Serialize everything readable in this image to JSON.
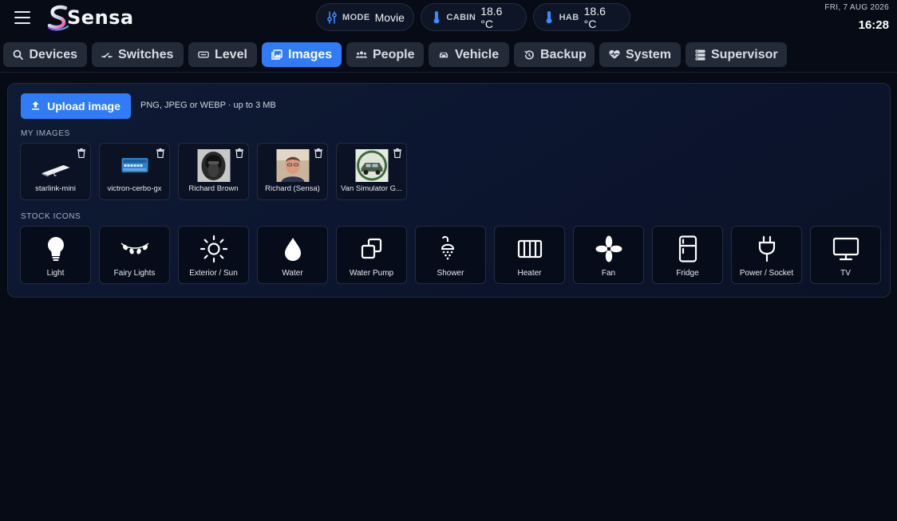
{
  "header": {
    "logo_text": "Sensa",
    "mode": {
      "label": "MODE",
      "value": "Movie"
    },
    "cabin": {
      "label": "CABIN",
      "value": "18.6 °C"
    },
    "hab": {
      "label": "HAB",
      "value": "18.6 °C"
    },
    "date": "FRI, 7 AUG 2026",
    "time": "16:28"
  },
  "tabs": [
    {
      "label": "Devices",
      "icon": "search-icon"
    },
    {
      "label": "Switches",
      "icon": "switch-icon"
    },
    {
      "label": "Level",
      "icon": "level-icon"
    },
    {
      "label": "Images",
      "icon": "image-icon",
      "active": true
    },
    {
      "label": "People",
      "icon": "people-icon"
    },
    {
      "label": "Vehicle",
      "icon": "car-icon"
    },
    {
      "label": "Backup",
      "icon": "history-icon"
    },
    {
      "label": "System",
      "icon": "heart-pulse-icon"
    },
    {
      "label": "Supervisor",
      "icon": "server-icon"
    }
  ],
  "upload": {
    "button_label": "Upload image",
    "hint": "PNG, JPEG or WEBP · up to 3 MB"
  },
  "my_images": {
    "heading": "MY IMAGES",
    "items": [
      {
        "name": "starlink-mini"
      },
      {
        "name": "victron-cerbo-gx"
      },
      {
        "name": "Richard Brown"
      },
      {
        "name": "Richard (Sensa)"
      },
      {
        "name": "Van Simulator G..."
      }
    ]
  },
  "stock_icons": {
    "heading": "STOCK ICONS",
    "items": [
      {
        "name": "Light",
        "icon": "lightbulb-icon"
      },
      {
        "name": "Fairy Lights",
        "icon": "fairy-lights-icon"
      },
      {
        "name": "Exterior / Sun",
        "icon": "sun-icon"
      },
      {
        "name": "Water",
        "icon": "water-drop-icon"
      },
      {
        "name": "Water Pump",
        "icon": "water-pump-icon"
      },
      {
        "name": "Shower",
        "icon": "shower-icon"
      },
      {
        "name": "Heater",
        "icon": "heater-icon"
      },
      {
        "name": "Fan",
        "icon": "fan-icon"
      },
      {
        "name": "Fridge",
        "icon": "fridge-icon"
      },
      {
        "name": "Power / Socket",
        "icon": "power-plug-icon"
      },
      {
        "name": "TV",
        "icon": "tv-icon"
      }
    ]
  },
  "colors": {
    "accent": "#2f7cf6",
    "background": "#070b16",
    "tab_inactive": "#242b38",
    "thermometer": "#3b8cff"
  }
}
